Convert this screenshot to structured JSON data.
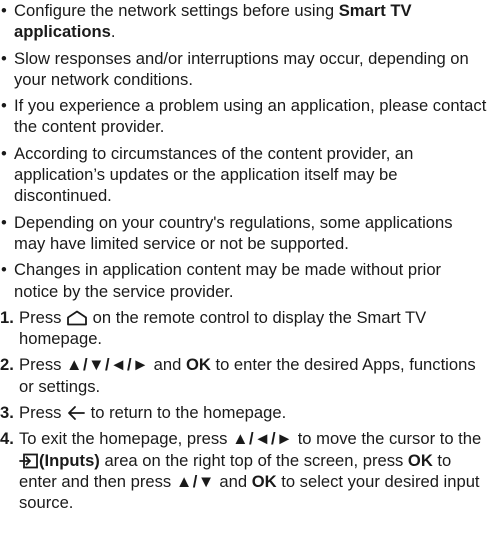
{
  "bullets": [
    {
      "lead": "Configure the network settings before using ",
      "bold": "Smart TV applications",
      "tail": "."
    },
    {
      "text": "Slow responses and/or interruptions may occur, depending on your network conditions."
    },
    {
      "text": "If you experience a problem using an application, please contact the content provider."
    },
    {
      "text": "According to circumstances of the content provider, an application’s updates or the application itself may be discontinued."
    },
    {
      "text": "Depending on your country's regulations, some applications may have limited service or not be supported."
    },
    {
      "text": "Changes in application content may be made without prior notice by the service provider."
    }
  ],
  "bullet_symbol": "•",
  "steps": [
    {
      "num": "1.",
      "a": "Press ",
      "icon": "home-icon",
      "b": " on the remote control to display the Smart TV homepage."
    },
    {
      "num": "2.",
      "a": "Press ",
      "keys": "▲/▼/◄/►",
      "b": " and ",
      "ok": "OK",
      "c": " to enter the desired Apps, functions or settings."
    },
    {
      "num": "3.",
      "a": "Press ",
      "icon": "back-arrow-icon",
      "b": " to return to the homepage."
    },
    {
      "num": "4.",
      "a": "To exit the homepage, press ",
      "keys1": "▲/◄/►",
      "b": " to move the cursor to the ",
      "icon": "inputs-icon",
      "inputs_label": "(Inputs)",
      "c": " area on the right top of the screen, press ",
      "ok1": "OK",
      "d": " to enter and then press ",
      "keys2": "▲/▼",
      "e": " and ",
      "ok2": "OK",
      "f": " to select your desired input source."
    }
  ]
}
